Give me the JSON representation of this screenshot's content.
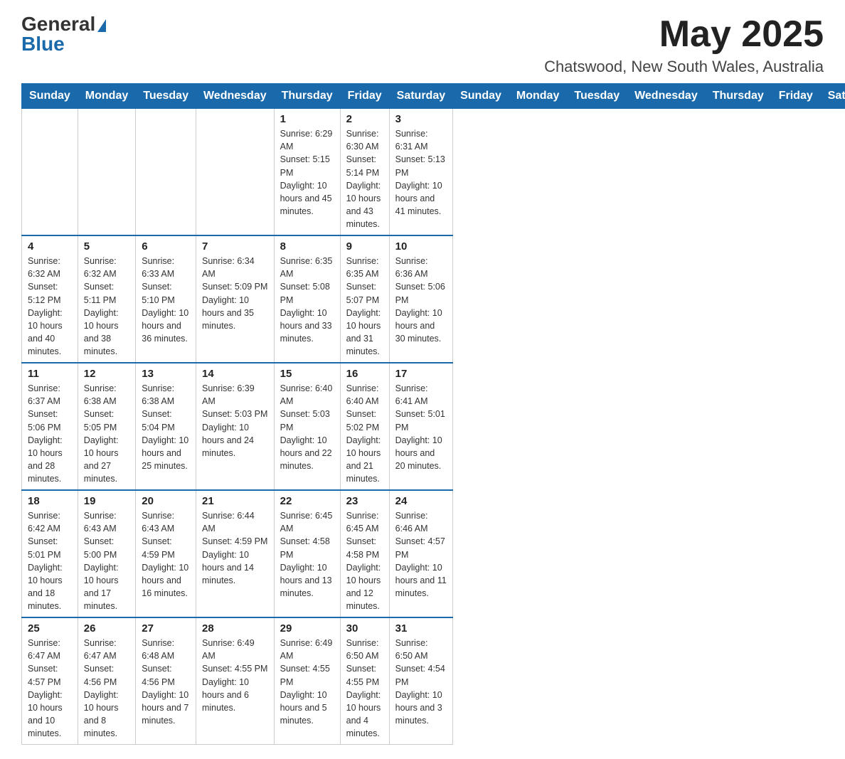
{
  "header": {
    "logo_general": "General",
    "logo_blue": "Blue",
    "month_year": "May 2025",
    "location": "Chatswood, New South Wales, Australia"
  },
  "columns": [
    "Sunday",
    "Monday",
    "Tuesday",
    "Wednesday",
    "Thursday",
    "Friday",
    "Saturday"
  ],
  "weeks": [
    [
      {
        "day": "",
        "info": ""
      },
      {
        "day": "",
        "info": ""
      },
      {
        "day": "",
        "info": ""
      },
      {
        "day": "",
        "info": ""
      },
      {
        "day": "1",
        "info": "Sunrise: 6:29 AM\nSunset: 5:15 PM\nDaylight: 10 hours and 45 minutes."
      },
      {
        "day": "2",
        "info": "Sunrise: 6:30 AM\nSunset: 5:14 PM\nDaylight: 10 hours and 43 minutes."
      },
      {
        "day": "3",
        "info": "Sunrise: 6:31 AM\nSunset: 5:13 PM\nDaylight: 10 hours and 41 minutes."
      }
    ],
    [
      {
        "day": "4",
        "info": "Sunrise: 6:32 AM\nSunset: 5:12 PM\nDaylight: 10 hours and 40 minutes."
      },
      {
        "day": "5",
        "info": "Sunrise: 6:32 AM\nSunset: 5:11 PM\nDaylight: 10 hours and 38 minutes."
      },
      {
        "day": "6",
        "info": "Sunrise: 6:33 AM\nSunset: 5:10 PM\nDaylight: 10 hours and 36 minutes."
      },
      {
        "day": "7",
        "info": "Sunrise: 6:34 AM\nSunset: 5:09 PM\nDaylight: 10 hours and 35 minutes."
      },
      {
        "day": "8",
        "info": "Sunrise: 6:35 AM\nSunset: 5:08 PM\nDaylight: 10 hours and 33 minutes."
      },
      {
        "day": "9",
        "info": "Sunrise: 6:35 AM\nSunset: 5:07 PM\nDaylight: 10 hours and 31 minutes."
      },
      {
        "day": "10",
        "info": "Sunrise: 6:36 AM\nSunset: 5:06 PM\nDaylight: 10 hours and 30 minutes."
      }
    ],
    [
      {
        "day": "11",
        "info": "Sunrise: 6:37 AM\nSunset: 5:06 PM\nDaylight: 10 hours and 28 minutes."
      },
      {
        "day": "12",
        "info": "Sunrise: 6:38 AM\nSunset: 5:05 PM\nDaylight: 10 hours and 27 minutes."
      },
      {
        "day": "13",
        "info": "Sunrise: 6:38 AM\nSunset: 5:04 PM\nDaylight: 10 hours and 25 minutes."
      },
      {
        "day": "14",
        "info": "Sunrise: 6:39 AM\nSunset: 5:03 PM\nDaylight: 10 hours and 24 minutes."
      },
      {
        "day": "15",
        "info": "Sunrise: 6:40 AM\nSunset: 5:03 PM\nDaylight: 10 hours and 22 minutes."
      },
      {
        "day": "16",
        "info": "Sunrise: 6:40 AM\nSunset: 5:02 PM\nDaylight: 10 hours and 21 minutes."
      },
      {
        "day": "17",
        "info": "Sunrise: 6:41 AM\nSunset: 5:01 PM\nDaylight: 10 hours and 20 minutes."
      }
    ],
    [
      {
        "day": "18",
        "info": "Sunrise: 6:42 AM\nSunset: 5:01 PM\nDaylight: 10 hours and 18 minutes."
      },
      {
        "day": "19",
        "info": "Sunrise: 6:43 AM\nSunset: 5:00 PM\nDaylight: 10 hours and 17 minutes."
      },
      {
        "day": "20",
        "info": "Sunrise: 6:43 AM\nSunset: 4:59 PM\nDaylight: 10 hours and 16 minutes."
      },
      {
        "day": "21",
        "info": "Sunrise: 6:44 AM\nSunset: 4:59 PM\nDaylight: 10 hours and 14 minutes."
      },
      {
        "day": "22",
        "info": "Sunrise: 6:45 AM\nSunset: 4:58 PM\nDaylight: 10 hours and 13 minutes."
      },
      {
        "day": "23",
        "info": "Sunrise: 6:45 AM\nSunset: 4:58 PM\nDaylight: 10 hours and 12 minutes."
      },
      {
        "day": "24",
        "info": "Sunrise: 6:46 AM\nSunset: 4:57 PM\nDaylight: 10 hours and 11 minutes."
      }
    ],
    [
      {
        "day": "25",
        "info": "Sunrise: 6:47 AM\nSunset: 4:57 PM\nDaylight: 10 hours and 10 minutes."
      },
      {
        "day": "26",
        "info": "Sunrise: 6:47 AM\nSunset: 4:56 PM\nDaylight: 10 hours and 8 minutes."
      },
      {
        "day": "27",
        "info": "Sunrise: 6:48 AM\nSunset: 4:56 PM\nDaylight: 10 hours and 7 minutes."
      },
      {
        "day": "28",
        "info": "Sunrise: 6:49 AM\nSunset: 4:55 PM\nDaylight: 10 hours and 6 minutes."
      },
      {
        "day": "29",
        "info": "Sunrise: 6:49 AM\nSunset: 4:55 PM\nDaylight: 10 hours and 5 minutes."
      },
      {
        "day": "30",
        "info": "Sunrise: 6:50 AM\nSunset: 4:55 PM\nDaylight: 10 hours and 4 minutes."
      },
      {
        "day": "31",
        "info": "Sunrise: 6:50 AM\nSunset: 4:54 PM\nDaylight: 10 hours and 3 minutes."
      }
    ]
  ]
}
